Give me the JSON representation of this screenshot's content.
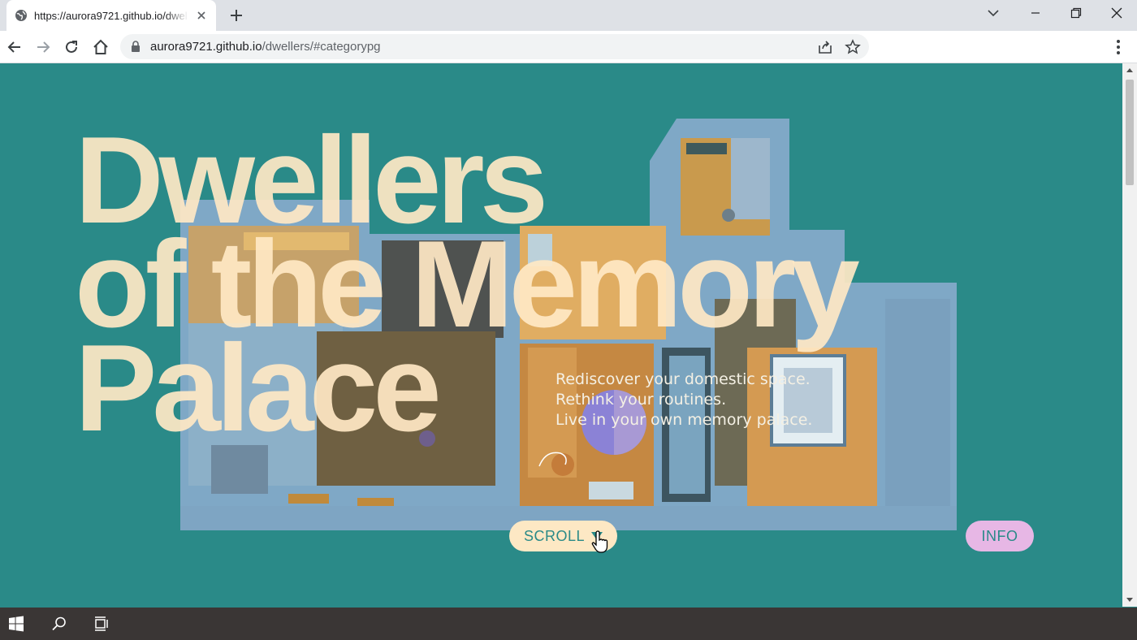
{
  "browser": {
    "tab_title": "https://aurora9721.github.io/dwellers/#categorypg",
    "url_host": "aurora9721.github.io",
    "url_path": "/dwellers/#categorypg"
  },
  "hero": {
    "title_lines": [
      "Dwellers",
      "of the Memory",
      "Palace"
    ],
    "tagline_lines": [
      "Rediscover your domestic space.",
      "Rethink your routines.",
      "Live in your own memory palace."
    ]
  },
  "buttons": {
    "scroll_label": "SCROLL",
    "info_label": "INFO"
  },
  "colors": {
    "background": "#2a8a88",
    "title_cream": "#ffe8c4",
    "scroll_button": "#fde8c4",
    "info_button": "#e7b7e5"
  }
}
